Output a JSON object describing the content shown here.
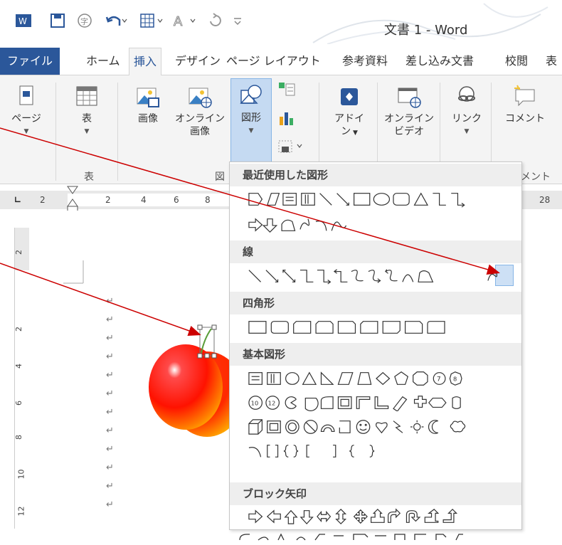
{
  "title_bar": {
    "doc_title": "文書 1 - Word",
    "quick_access_icons": [
      "word-logo-icon",
      "save-icon",
      "format-icon",
      "undo-icon",
      "table-icon",
      "font-icon",
      "redo-icon",
      "customize-icon"
    ]
  },
  "tabs": [
    {
      "label": "ファイル",
      "state": "file"
    },
    {
      "label": "ホーム"
    },
    {
      "label": "挿入",
      "state": "active"
    },
    {
      "label": "デザイン"
    },
    {
      "label": "ページ レイアウト"
    },
    {
      "label": "参考資料"
    },
    {
      "label": "差し込み文書"
    },
    {
      "label": "校閲"
    },
    {
      "label": "表"
    }
  ],
  "ribbon": {
    "page_label": "ページ",
    "table_label": "表",
    "table_group": "表",
    "picture_label": "画像",
    "online_picture_line1": "オンライン",
    "online_picture_line2": "画像",
    "shapes_label": "図形",
    "illustrations_group": "図",
    "addin_label": "アドイ",
    "addin_label2": "ン",
    "online_video_line1": "オンライン",
    "online_video_line2": "ビデオ",
    "link_label": "リンク",
    "comment_label": "コメント",
    "comment_group": "メント"
  },
  "ruler": {
    "numbers": [
      "2",
      "2",
      "4",
      "6",
      "8",
      "28"
    ],
    "vertical_numbers": [
      "2",
      "2",
      "4",
      "6",
      "8",
      "10",
      "12"
    ]
  },
  "shapes_menu": {
    "recent_header": "最近使用した図形",
    "lines_header": "線",
    "rectangles_header": "四角形",
    "basic_header": "基本図形",
    "block_arrows_header": "ブロック矢印"
  },
  "document": {
    "paragraph_mark": "↵"
  },
  "colors": {
    "brand": "#2b579a",
    "ribbon_bg": "#f4f4f4",
    "highlight": "#cde0f5",
    "arrow": "#cc0000",
    "apple": "#ff2a00"
  }
}
